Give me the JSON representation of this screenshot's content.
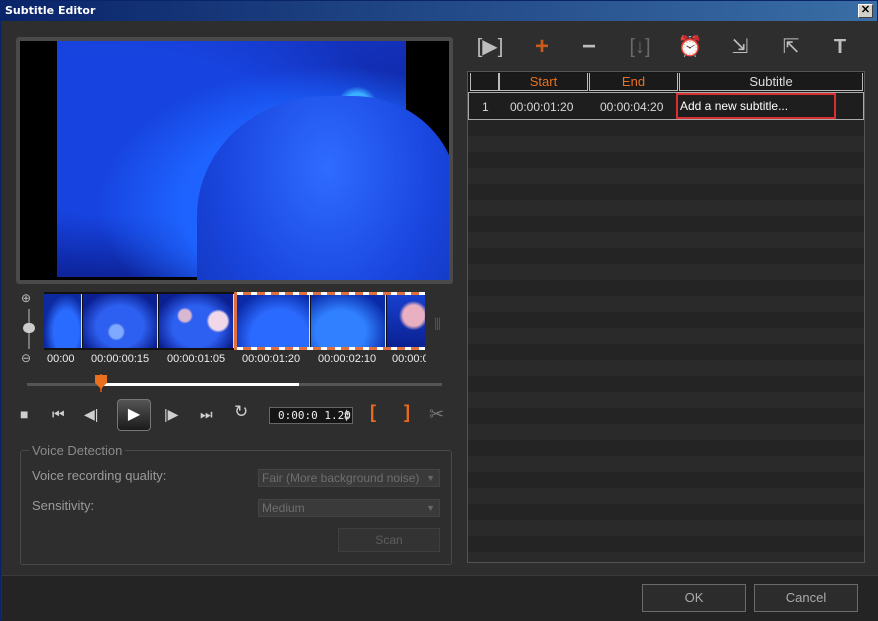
{
  "window": {
    "title": "Subtitle Editor",
    "close_glyph": "✕"
  },
  "timeline": {
    "labels": [
      "00:00",
      "00:00:00:15",
      "00:00:01:05",
      "00:00:01:20",
      "00:00:02:10",
      "00:00:0"
    ],
    "zoom_in_icon": "zoom-in-icon",
    "zoom_out_icon": "zoom-out-icon",
    "playhead_fraction": 0.18
  },
  "transport": {
    "timecode": "0:00:0 1.20"
  },
  "voice_detection": {
    "legend": "Voice Detection",
    "quality_label": "Voice recording quality:",
    "quality_value": "Fair (More background noise)",
    "sensitivity_label": "Sensitivity:",
    "sensitivity_value": "Medium",
    "scan_label": "Scan"
  },
  "table": {
    "columns": [
      "",
      "Start",
      "End",
      "Subtitle"
    ],
    "rows": [
      {
        "index": "1",
        "start": "00:00:01:20",
        "end": "00:00:04:20",
        "subtitle": "Add a new subtitle..."
      }
    ]
  },
  "buttons": {
    "ok": "OK",
    "cancel": "Cancel"
  },
  "colors": {
    "accent": "#e8701e",
    "highlight_border": "#d83030"
  }
}
